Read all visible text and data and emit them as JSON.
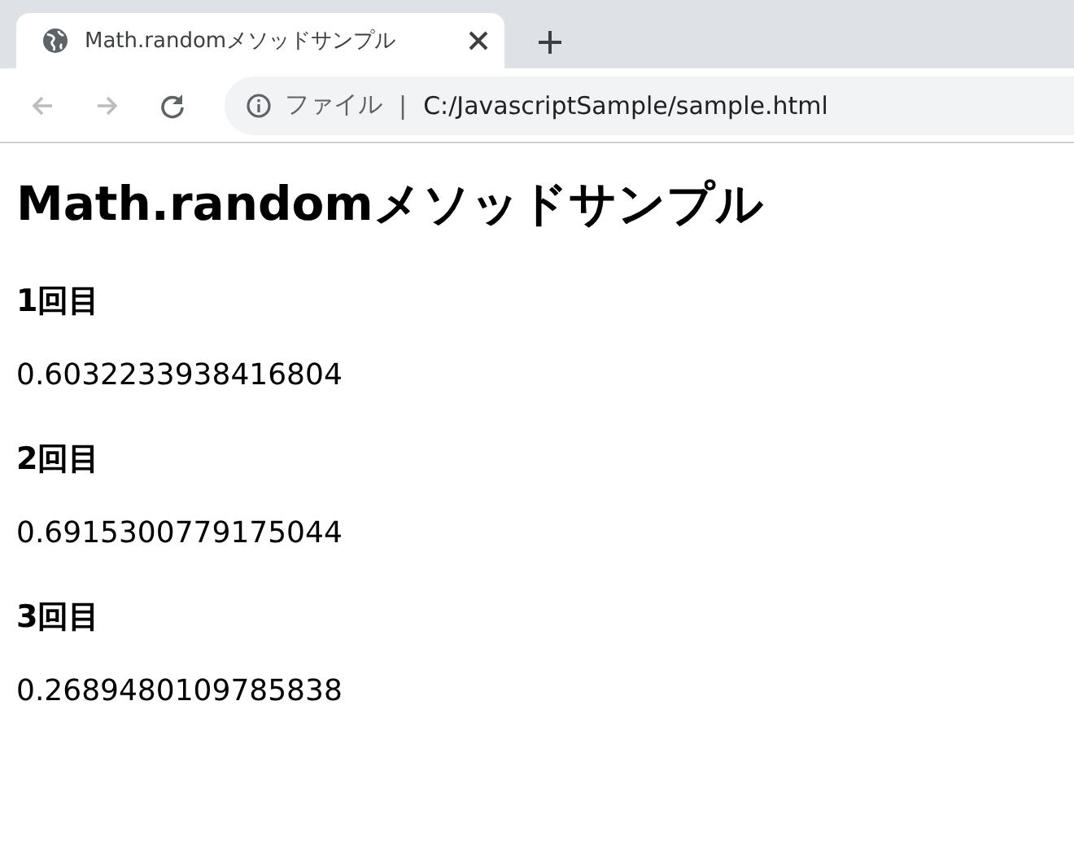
{
  "tabs": [
    {
      "title": "Math.randomメソッドサンプル",
      "selected": true
    }
  ],
  "nav_buttons": [
    {
      "kind": "back",
      "disabled": true
    },
    {
      "kind": "forward",
      "disabled": true
    },
    {
      "kind": "reload",
      "disabled": false
    }
  ],
  "address_bar": {
    "scheme_label": "ファイル",
    "separator": "|",
    "url": "C:/JavascriptSample/sample.html"
  },
  "page": {
    "heading": "Math.randomメソッドサンプル",
    "sections": [
      {
        "heading": "1回目",
        "value": "0.6032233938416804"
      },
      {
        "heading": "2回目",
        "value": "0.6915300779175044"
      },
      {
        "heading": "3回目",
        "value": "0.2689480109785838"
      }
    ]
  }
}
